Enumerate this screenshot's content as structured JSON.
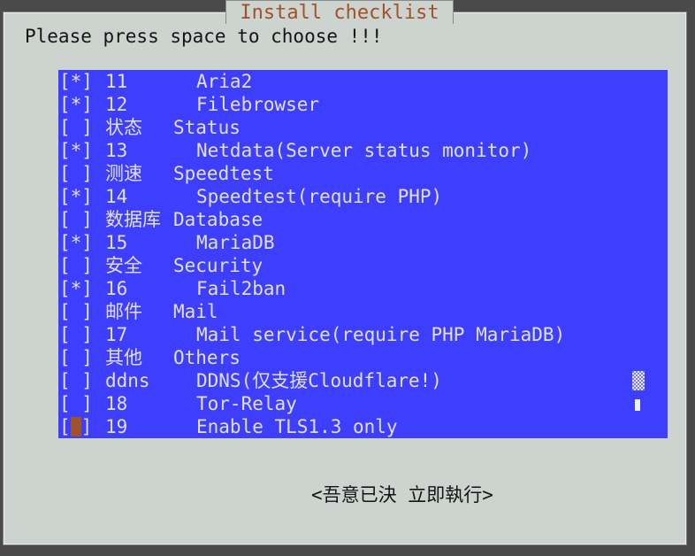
{
  "dialog": {
    "title": "Install checklist",
    "prompt": "Please press space to choose !!!",
    "ok_button": "<吾意已決 立即執行>"
  },
  "items": [
    {
      "check": "[*]",
      "tag": "11",
      "label": "Aria2",
      "header": false
    },
    {
      "check": "[*]",
      "tag": "12",
      "label": "Filebrowser",
      "header": false
    },
    {
      "check": "[ ]",
      "tag": "状态",
      "label": "Status",
      "header": true
    },
    {
      "check": "[*]",
      "tag": "13",
      "label": "Netdata(Server status monitor)",
      "header": false
    },
    {
      "check": "[ ]",
      "tag": "测速",
      "label": "Speedtest",
      "header": true
    },
    {
      "check": "[*]",
      "tag": "14",
      "label": "Speedtest(require PHP)",
      "header": false
    },
    {
      "check": "[ ]",
      "tag": "数据库",
      "label": "Database",
      "header": true
    },
    {
      "check": "[*]",
      "tag": "15",
      "label": "MariaDB",
      "header": false
    },
    {
      "check": "[ ]",
      "tag": "安全",
      "label": "Security",
      "header": true
    },
    {
      "check": "[*]",
      "tag": "16",
      "label": "Fail2ban",
      "header": false
    },
    {
      "check": "[ ]",
      "tag": "邮件",
      "label": "Mail",
      "header": true
    },
    {
      "check": "[ ]",
      "tag": "17",
      "label": "Mail service(require PHP MariaDB)",
      "header": false
    },
    {
      "check": "[ ]",
      "tag": "其他",
      "label": "Others",
      "header": true
    },
    {
      "check": "[ ]",
      "tag": "ddns",
      "label": "DDNS(仅支援Cloudflare!)",
      "header": false
    },
    {
      "check": "[ ]",
      "tag": "18",
      "label": "Tor-Relay",
      "header": false
    },
    {
      "check": "[ ]",
      "tag": "19",
      "label": "Enable TLS1.3 only",
      "header": false,
      "cursor": true
    }
  ],
  "colors": {
    "dialog_bg": "#cdd3ce",
    "list_bg": "#3e3eff",
    "list_text": "#e0e0e0",
    "title_text": "#a0522d",
    "cursor": "#a0522d"
  },
  "icons": {
    "scrollbar": "scroll-thumb-icon"
  }
}
